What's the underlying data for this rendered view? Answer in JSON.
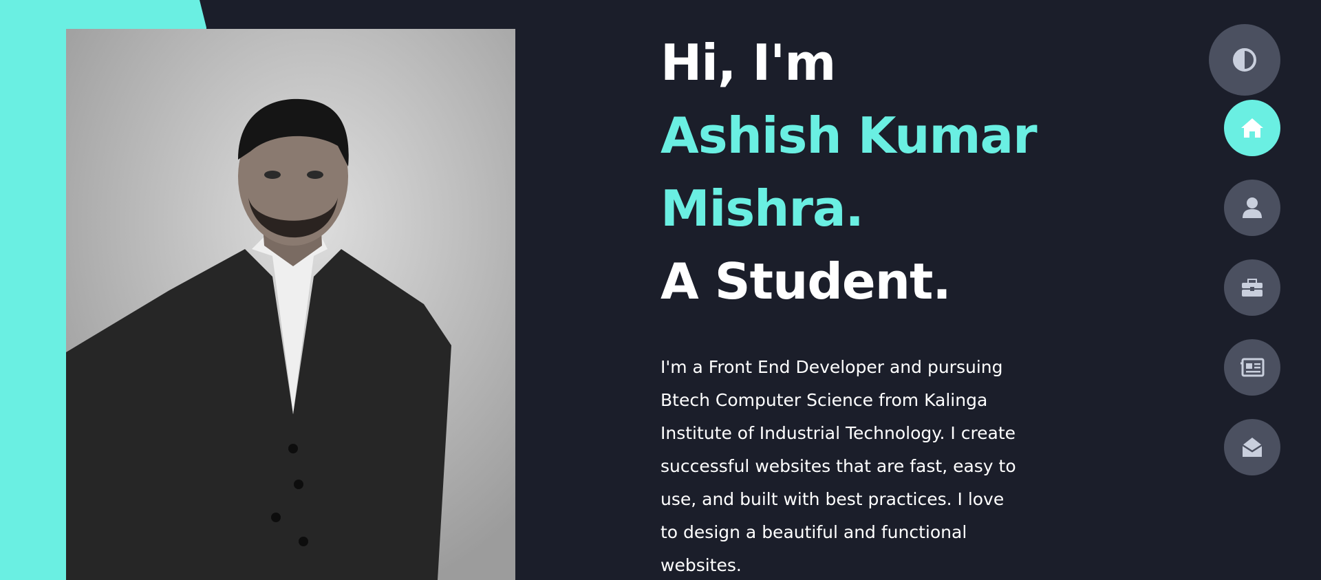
{
  "hero": {
    "greeting": "Hi, I'm",
    "name_line1": "Ashish Kumar",
    "name_line2": "Mishra.",
    "role": "A Student.",
    "bio": "I'm a Front End Developer and pursuing Btech Computer Science from Kalinga Institute of Industrial Technology. I create successful websites that are fast, easy to use, and built with best practices. I love to design a beautiful and functional websites."
  },
  "colors": {
    "background": "#1b1e2a",
    "accent": "#6aefe2",
    "button_bg": "#4b5060",
    "icon_color": "#c9cfdd"
  },
  "theme_toggle": {
    "icon": "contrast-icon"
  },
  "nav": {
    "items": [
      {
        "icon": "home-icon",
        "active": true
      },
      {
        "icon": "user-icon",
        "active": false
      },
      {
        "icon": "briefcase-icon",
        "active": false
      },
      {
        "icon": "newspaper-icon",
        "active": false
      },
      {
        "icon": "envelope-open-icon",
        "active": false
      }
    ]
  }
}
